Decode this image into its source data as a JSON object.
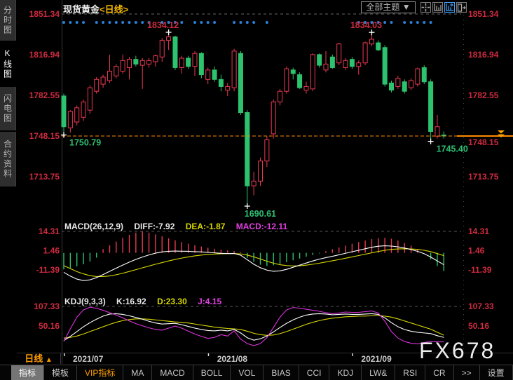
{
  "header": {
    "title": "现货黄金",
    "period_tag": "<日线>",
    "theme_button": "全部主题",
    "theme_arrow": "▼"
  },
  "sidebar": {
    "items": [
      {
        "label": "分时图",
        "selected": false
      },
      {
        "label": "K线图",
        "selected": true
      },
      {
        "label": "闪电图",
        "selected": false
      },
      {
        "label": "合约资料",
        "selected": false
      }
    ]
  },
  "watermark": "FX678",
  "footer": {
    "period_label": "日线",
    "period_arrow": "▲",
    "tabs": [
      {
        "label": "指标",
        "selected": true
      },
      {
        "label": "模板"
      },
      {
        "label": "VIP指标",
        "vip": true
      },
      {
        "label": "MA"
      },
      {
        "label": "MACD"
      },
      {
        "label": "BOLL"
      },
      {
        "label": "VOL"
      },
      {
        "label": "BIAS"
      },
      {
        "label": "CCI"
      },
      {
        "label": "KDJ"
      },
      {
        "label": "LW&"
      },
      {
        "label": "RSI"
      },
      {
        "label": "CR"
      },
      {
        "label": ">>"
      },
      {
        "label": "设置"
      }
    ]
  },
  "colors": {
    "up": "#ea3a52",
    "down": "#2dc36e",
    "red_text": "#cf2b3f",
    "green_text": "#2fbe72",
    "dot": "#2a7fd4",
    "orange": "#ff8a00",
    "white_line": "#ffffff",
    "yellow_line": "#d8d800",
    "magenta_line": "#dd33dd",
    "grid": "#666666",
    "axis_border": "#3a3a3a"
  },
  "chart_data": {
    "type": "candlestick+indicators",
    "instrument": "现货黄金",
    "period": "日线",
    "price_axis": [
      1851.34,
      1816.94,
      1782.55,
      1748.15,
      1713.75
    ],
    "last_price": 1748.15,
    "session_high_line": 1851.34,
    "x_labels": [
      {
        "text": "2021/07",
        "idx": 1
      },
      {
        "text": "2021/08",
        "idx": 23
      },
      {
        "text": "2021/09",
        "idx": 45
      }
    ],
    "annotations": [
      {
        "text": "1750.79",
        "idx": 1,
        "side": "low"
      },
      {
        "text": "1834.12",
        "idx": 17,
        "side": "high"
      },
      {
        "text": "1690.61",
        "idx": 29,
        "side": "low"
      },
      {
        "text": "1834.03",
        "idx": 48,
        "side": "high"
      },
      {
        "text": "1745.40",
        "idx": 57,
        "side": "low"
      }
    ],
    "dots_indices": [
      1,
      2,
      3,
      4,
      6,
      7,
      8,
      9,
      10,
      11,
      12,
      13,
      14,
      16,
      17,
      18,
      19,
      21,
      22,
      23,
      24,
      27,
      28,
      29,
      30,
      32,
      46,
      47,
      48,
      49,
      50,
      51,
      53,
      54,
      55,
      56,
      57
    ],
    "candles": [
      [
        1782,
        1784,
        1750.79,
        1756
      ],
      [
        1755,
        1770,
        1751,
        1769
      ],
      [
        1760,
        1774,
        1757,
        1772
      ],
      [
        1764,
        1779,
        1761,
        1777
      ],
      [
        1770,
        1791,
        1767,
        1789
      ],
      [
        1786,
        1798,
        1784,
        1796
      ],
      [
        1792,
        1800,
        1789,
        1798
      ],
      [
        1795,
        1817,
        1793,
        1803
      ],
      [
        1799,
        1809,
        1797,
        1807
      ],
      [
        1803,
        1817,
        1801,
        1812
      ],
      [
        1806,
        1815,
        1796,
        1813
      ],
      [
        1813,
        1816,
        1807,
        1809
      ],
      [
        1808,
        1814,
        1788,
        1812
      ],
      [
        1809,
        1814,
        1806,
        1812
      ],
      [
        1811,
        1817,
        1807,
        1816
      ],
      [
        1815,
        1831,
        1811,
        1829
      ],
      [
        1829,
        1834.12,
        1821,
        1832
      ],
      [
        1832,
        1833,
        1804,
        1806
      ],
      [
        1806,
        1816,
        1801,
        1814
      ],
      [
        1814,
        1816,
        1805,
        1807
      ],
      [
        1807,
        1820,
        1799,
        1818
      ],
      [
        1818,
        1819,
        1797,
        1800
      ],
      [
        1796,
        1806,
        1792,
        1804
      ],
      [
        1804,
        1807,
        1794,
        1796
      ],
      [
        1796,
        1800,
        1786,
        1790
      ],
      [
        1787,
        1793,
        1782,
        1790
      ],
      [
        1789,
        1822,
        1786,
        1820
      ],
      [
        1818,
        1820,
        1766,
        1768
      ],
      [
        1768,
        1770,
        1690.61,
        1706
      ],
      [
        1706,
        1718,
        1698,
        1710
      ],
      [
        1710,
        1730,
        1706,
        1727
      ],
      [
        1727,
        1748,
        1722,
        1745
      ],
      [
        1750,
        1779,
        1746,
        1777
      ],
      [
        1777,
        1788,
        1774,
        1786
      ],
      [
        1786,
        1807,
        1784,
        1805
      ],
      [
        1804,
        1806,
        1796,
        1801
      ],
      [
        1800,
        1802,
        1788,
        1789
      ],
      [
        1787,
        1794,
        1784,
        1790
      ],
      [
        1788,
        1818,
        1786,
        1817
      ],
      [
        1817,
        1818,
        1806,
        1808
      ],
      [
        1804,
        1820,
        1802,
        1809
      ],
      [
        1815,
        1817,
        1805,
        1806
      ],
      [
        1810,
        1827,
        1808,
        1826
      ],
      [
        1806,
        1814,
        1804,
        1812
      ],
      [
        1813,
        1815,
        1805,
        1807
      ],
      [
        1807,
        1812,
        1800,
        1810
      ],
      [
        1810,
        1828,
        1808,
        1827
      ],
      [
        1826,
        1834.03,
        1824,
        1830
      ],
      [
        1827,
        1829,
        1820,
        1821
      ],
      [
        1823,
        1825,
        1790,
        1792
      ],
      [
        1793,
        1795,
        1785,
        1787
      ],
      [
        1790,
        1799,
        1788,
        1797
      ],
      [
        1794,
        1796,
        1784,
        1786
      ],
      [
        1789,
        1797,
        1787,
        1795
      ],
      [
        1792,
        1806,
        1790,
        1805
      ],
      [
        1806,
        1808,
        1792,
        1794
      ],
      [
        1794,
        1796,
        1745.4,
        1752
      ],
      [
        1748,
        1766,
        1746,
        1756
      ],
      [
        1749,
        1752,
        1746,
        1748.15
      ]
    ],
    "macd": {
      "label_name": "MACD(26,12,9)",
      "label_diff": "DIFF:-7.92",
      "label_dea": "DEA:-1.87",
      "label_macd": "MACD:-12.11",
      "diff": -7.92,
      "dea": -1.87,
      "macd": -12.11,
      "axis": [
        14.31,
        1.46,
        -11.39
      ],
      "diff_series": [
        -13,
        -15.5,
        -17.5,
        -18.5,
        -18,
        -16.5,
        -14.5,
        -12.3,
        -10.2,
        -8.2,
        -6.2,
        -4.4,
        -2.8,
        -1.4,
        -0.2,
        0.6,
        1,
        1.2,
        1.1,
        1,
        0.8,
        0.6,
        0.3,
        0,
        -0.3,
        -0.5,
        -0.4,
        -1.6,
        -4.6,
        -7.6,
        -9.9,
        -11.5,
        -12.3,
        -12,
        -11,
        -9.6,
        -8.2,
        -6.8,
        -5.4,
        -4.2,
        -3.2,
        -2.3,
        -1.3,
        -0.3,
        0.7,
        1.7,
        2.7,
        3.7,
        4.4,
        4.7,
        4.5,
        4,
        3.2,
        2.2,
        1,
        -0.6,
        -2.8,
        -5.4,
        -7.92
      ],
      "dea_series": [
        -8.5,
        -10.5,
        -12.5,
        -14,
        -15.2,
        -15.8,
        -15.8,
        -15.4,
        -14.6,
        -13.6,
        -12.4,
        -11.2,
        -10,
        -8.8,
        -7.6,
        -6.5,
        -5.4,
        -4.4,
        -3.5,
        -2.7,
        -2,
        -1.5,
        -1.1,
        -0.8,
        -0.6,
        -0.5,
        -0.5,
        -0.7,
        -1.5,
        -2.7,
        -4.1,
        -5.6,
        -6.9,
        -7.9,
        -8.5,
        -8.7,
        -8.6,
        -8.2,
        -7.6,
        -6.9,
        -6.1,
        -5.3,
        -4.5,
        -3.6,
        -2.7,
        -1.8,
        -0.9,
        0,
        0.9,
        1.7,
        2.3,
        2.6,
        2.7,
        2.6,
        2.3,
        1.7,
        0.8,
        -0.5,
        -1.87
      ],
      "hist_series": [
        -11,
        -10.2,
        -9,
        -7.6,
        -5.8,
        -3.2,
        2.5,
        5,
        7.5,
        10,
        12,
        13.5,
        14.31,
        13.5,
        12.3,
        11,
        9.7,
        8.4,
        7.2,
        6.1,
        5.1,
        4.2,
        3.4,
        2.7,
        2.1,
        1.6,
        1.2,
        0.6,
        -3.4,
        -6,
        -7.9,
        -8.7,
        -8.3,
        -7.4,
        -6.2,
        -5,
        -3.8,
        -2.6,
        -1.4,
        -0.4,
        1.2,
        2.4,
        3.6,
        4.8,
        6,
        7.2,
        8.2,
        9.2,
        9.8,
        10,
        9.4,
        8.2,
        6.6,
        4.8,
        2.6,
        0,
        -4.4,
        -8.8,
        -12.11
      ]
    },
    "kdj": {
      "label_name": "KDJ(9,3,3)",
      "label_k": "K:16.92",
      "label_d": "D:23.30",
      "label_j": "J:4.15",
      "k": 16.92,
      "d": 23.3,
      "j": 4.15,
      "axis": [
        107.33,
        50.16
      ],
      "k_series": [
        8,
        20,
        34,
        48,
        60,
        70,
        79,
        85,
        86,
        84,
        80,
        75,
        70,
        64,
        59,
        56,
        57,
        58,
        54,
        49,
        44,
        40,
        37,
        36,
        38,
        36,
        40,
        30,
        16,
        9,
        13,
        21,
        33,
        46,
        58,
        68,
        76,
        82,
        85,
        86,
        85,
        83,
        84,
        85,
        84,
        84,
        85,
        86,
        84,
        74,
        60,
        48,
        40,
        35,
        32,
        30,
        28,
        22,
        16.92
      ],
      "d_series": [
        15,
        17,
        21,
        27,
        34,
        41,
        48,
        55,
        61,
        66,
        69,
        71,
        71,
        70,
        68,
        66,
        64,
        62,
        61,
        59,
        56,
        53,
        50,
        47,
        45,
        43,
        42,
        40,
        35,
        29,
        25,
        23,
        24,
        28,
        34,
        41,
        48,
        55,
        61,
        66,
        70,
        73,
        75,
        77,
        78,
        79,
        79,
        80,
        80,
        79,
        76,
        71,
        65,
        59,
        53,
        47,
        41,
        32,
        23.3
      ],
      "j_series": [
        5,
        42,
        76,
        97,
        105,
        102,
        96,
        89,
        82,
        74,
        65,
        57,
        51,
        45,
        40,
        38,
        44,
        50,
        44,
        35,
        27,
        20,
        14,
        17,
        25,
        21,
        36,
        12,
        -1,
        -7,
        -1,
        16,
        46,
        76,
        97,
        104,
        102,
        99,
        96,
        93,
        89,
        86,
        88,
        91,
        90,
        90,
        92,
        94,
        88,
        64,
        34,
        15,
        5,
        0,
        -2,
        2,
        5,
        4,
        4.15
      ]
    }
  }
}
